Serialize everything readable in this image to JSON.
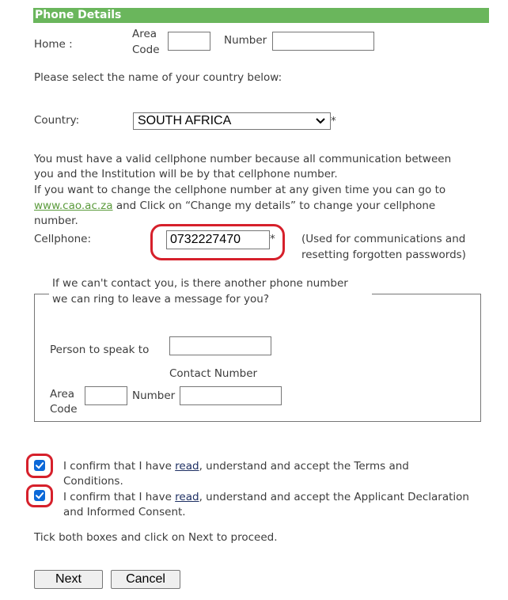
{
  "section_title": "Phone Details",
  "home": {
    "label": "Home :",
    "area_code_label_1": "Area",
    "area_code_label_2": "Code",
    "area_code_value": "",
    "number_label": "Number",
    "number_value": ""
  },
  "country_prompt": "Please select the name of your country below:",
  "country": {
    "label": "Country:",
    "selected": "SOUTH AFRICA",
    "required_mark": "*"
  },
  "cell_info": {
    "line1": "You must have a valid cellphone number because all communication between",
    "line2": "you and the Institution will be by that cellphone number.",
    "line3": "If you want to change the cellphone number at any given time you can go to",
    "link": "www.cao.ac.za",
    "line4_after_link": " and Click on “Change my details” to change your cellphone",
    "line5": "number."
  },
  "cellphone": {
    "label": "Cellphone:",
    "value": "0732227470",
    "required_mark": "*",
    "note_line1": "(Used for communications and",
    "note_line2": "resetting forgotten passwords)"
  },
  "alternate": {
    "legend_line1": "If we can't contact you, is there another phone number",
    "legend_line2": "we can ring to leave a message for you?",
    "person_label": "Person to speak to",
    "person_value": "",
    "contact_number_label": "Contact Number",
    "area_label_1": "Area",
    "area_label_2": "Code",
    "area_value": "",
    "number_label": "Number",
    "number_value": ""
  },
  "terms": {
    "prefix": "I confirm that I have ",
    "read_link": "read",
    "suffix_line1": ", understand and accept the Terms and",
    "line2": "Conditions.",
    "checked": true
  },
  "declaration": {
    "prefix": "I confirm that I have ",
    "read_link": "read",
    "suffix_line1": ", understand and accept the Applicant Declaration",
    "line2": "and Informed Consent.",
    "checked": true
  },
  "instruction": "Tick both boxes and click on Next to proceed.",
  "buttons": {
    "next": "Next",
    "cancel": "Cancel"
  },
  "colors": {
    "header_bg": "#6ab65c",
    "highlight_ring": "#d6202b",
    "checkbox_blue": "#0b68d8",
    "link_green": "#5b9b3c"
  }
}
